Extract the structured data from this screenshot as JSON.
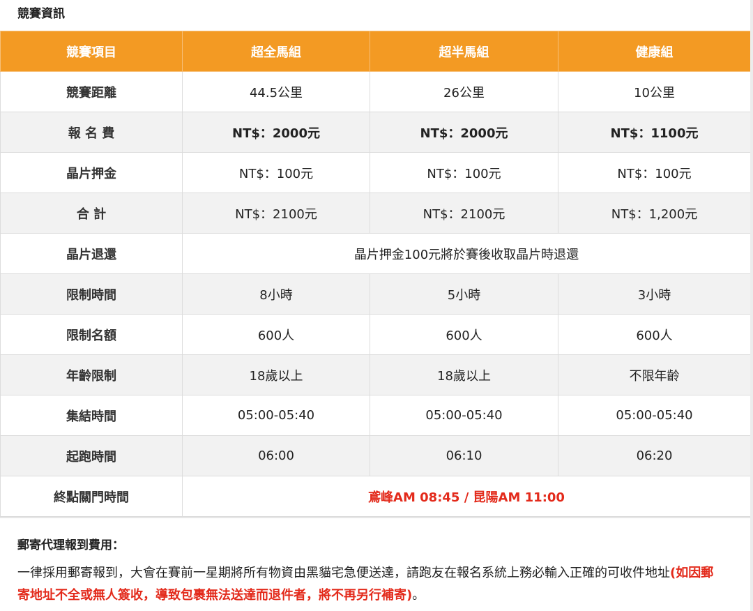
{
  "section_title": "競賽資訊",
  "table": {
    "headers": [
      "競賽項目",
      "超全馬組",
      "超半馬組",
      "健康組"
    ],
    "rows": {
      "distance": {
        "label": "競賽距離",
        "values": [
          "44.5公里",
          "26公里",
          "10公里"
        ]
      },
      "fee": {
        "label": "報 名 費",
        "values": [
          "NT$：2000元",
          "NT$：2000元",
          "NT$：1100元"
        ]
      },
      "deposit": {
        "label": "晶片押金",
        "values": [
          "NT$：100元",
          "NT$：100元",
          "NT$：100元"
        ]
      },
      "total": {
        "label": "合 計",
        "values": [
          "NT$：2100元",
          "NT$：2100元",
          "NT$：1,200元"
        ]
      },
      "chip_return": {
        "label": "晶片退還",
        "value": "晶片押金100元將於賽後收取晶片時退還"
      },
      "time_limit": {
        "label": "限制時間",
        "values": [
          "8小時",
          "5小時",
          "3小時"
        ]
      },
      "quota": {
        "label": "限制名額",
        "values": [
          "600人",
          "600人",
          "600人"
        ]
      },
      "age": {
        "label": "年齡限制",
        "values": [
          "18歲以上",
          "18歲以上",
          "不限年齡"
        ]
      },
      "assembly": {
        "label": "集結時間",
        "values": [
          "05:00-05:40",
          "05:00-05:40",
          "05:00-05:40"
        ]
      },
      "start": {
        "label": "起跑時間",
        "values": [
          "06:00",
          "06:10",
          "06:20"
        ]
      },
      "closing": {
        "label": "終點關門時間",
        "value": "鳶峰AM 08:45 / 昆陽AM 11:00"
      }
    }
  },
  "notes": {
    "heading": "郵寄代理報到費用：",
    "body_prefix": "一律採用郵寄報到，大會在賽前一星期將所有物資由黑貓宅急便送達，請跑友在報名系統上務必輸入正確的可收件地址",
    "body_warning": "(如因郵寄地址不全或無人簽收，導致包裹無法送達而退件者，將不再另行補寄)",
    "body_suffix": "。"
  },
  "colors": {
    "header_bg": "#f39a23",
    "warning": "#e32a1b"
  }
}
